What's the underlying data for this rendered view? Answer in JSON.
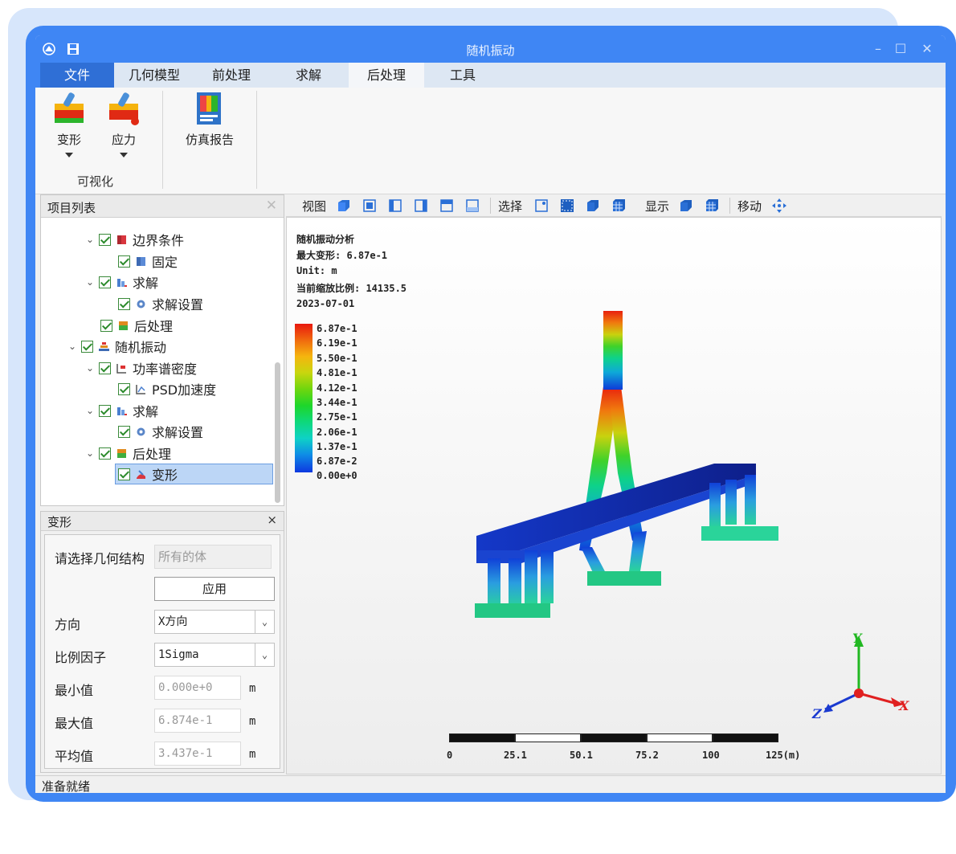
{
  "window": {
    "title": "随机振动"
  },
  "tabs": [
    {
      "label": "文件"
    },
    {
      "label": "几何模型"
    },
    {
      "label": "前处理"
    },
    {
      "label": "求解"
    },
    {
      "label": "后处理"
    },
    {
      "label": "工具"
    }
  ],
  "ribbon": {
    "deform_label": "变形",
    "stress_label": "应力",
    "report_label": "仿真报告",
    "group_visual": "可视化"
  },
  "project": {
    "title": "项目列表",
    "close": "✕",
    "tree": [
      {
        "label": "边界条件"
      },
      {
        "label": "固定"
      },
      {
        "label": "求解"
      },
      {
        "label": "求解设置"
      },
      {
        "label": "后处理"
      },
      {
        "label": "随机振动"
      },
      {
        "label": "功率谱密度"
      },
      {
        "label": "PSD加速度"
      },
      {
        "label": "求解"
      },
      {
        "label": "求解设置"
      },
      {
        "label": "后处理"
      },
      {
        "label": "变形"
      }
    ]
  },
  "props": {
    "title": "变形",
    "close": "×",
    "geom_label": "请选择几何结构",
    "geom_value": "所有的体",
    "apply_label": "应用",
    "direction_label": "方向",
    "direction_value": "X方向",
    "scale_label": "比例因子",
    "scale_value": "1Sigma",
    "min_label": "最小值",
    "min_value": "0.000e+0",
    "max_label": "最大值",
    "max_value": "6.874e-1",
    "avg_label": "平均值",
    "avg_value": "3.437e-1",
    "unit": "m"
  },
  "viewtool": {
    "view_label": "视图",
    "select_label": "选择",
    "display_label": "显示",
    "move_label": "移动"
  },
  "viewport": {
    "info": [
      "随机振动分析",
      "最大变形: 6.87e-1",
      "Unit: m",
      "当前缩放比例: 14135.5",
      "2023-07-01"
    ],
    "legend": [
      "6.87e-1",
      "6.19e-1",
      "5.50e-1",
      "4.81e-1",
      "4.12e-1",
      "3.44e-1",
      "2.75e-1",
      "2.06e-1",
      "1.37e-1",
      "6.87e-2",
      "0.00e+0"
    ],
    "scale_labels": [
      "0",
      "25.1",
      "50.1",
      "75.2",
      "100",
      "125(m)"
    ],
    "axes": {
      "x": "X",
      "y": "Y",
      "z": "Z"
    }
  },
  "status": {
    "text": "准备就绪"
  },
  "colors": {
    "accent": "#3f86f4",
    "file_tab": "#2f6fd6",
    "selection": "#bcd6f6"
  }
}
